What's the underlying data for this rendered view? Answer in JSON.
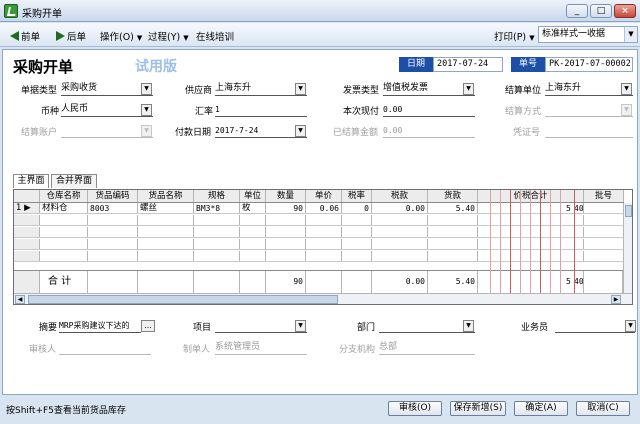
{
  "window": {
    "title": "采购开单",
    "min": "_",
    "max": "□",
    "close": "×"
  },
  "toolbar": {
    "prev": "前单",
    "next": "后单",
    "operate": "操作(O)",
    "process": "过程(Y)",
    "training": "在线培训",
    "print": "打印(P)",
    "style_select": "标准样式一收据",
    "caret": "▼"
  },
  "form": {
    "title": "采购开单",
    "trial": "试用版",
    "date_label": "日期",
    "date_value": "2017-07-24",
    "no_label": "单号",
    "no_value": "PK-2017-07-00002",
    "row1": [
      {
        "label": "单据类型",
        "value": "采购收货"
      },
      {
        "label": "供应商",
        "value": "上海东升"
      },
      {
        "label": "发票类型",
        "value": "增值税发票"
      },
      {
        "label": "结算单位",
        "value": "上海东升"
      }
    ],
    "row2": [
      {
        "label": "币种",
        "value": "人民币"
      },
      {
        "label": "汇率",
        "value": "1"
      },
      {
        "label": "本次现付",
        "value": "0.00"
      },
      {
        "label": "结算方式",
        "value": ""
      }
    ],
    "row3": [
      {
        "label": "结算账户",
        "value": ""
      },
      {
        "label": "付款日期",
        "value": "2017-7-24"
      },
      {
        "label": "已结算金额",
        "value": "0.00"
      },
      {
        "label": "凭证号",
        "value": ""
      }
    ]
  },
  "tabs": {
    "main": "主界面",
    "merge": "合并界面"
  },
  "grid": {
    "headers": [
      "仓库名称",
      "货品编码",
      "货品名称",
      "规格",
      "单位",
      "数量",
      "单价",
      "税率",
      "税款",
      "货款",
      "价税合计",
      "批号"
    ],
    "rows": [
      {
        "idx": "1",
        "marker": "▶",
        "warehouse": "材料仓",
        "code": "8003",
        "name": "螺丝",
        "spec": "BM3*8",
        "unit": "枚",
        "qty": "90",
        "price": "0.06",
        "tax_rate": "0",
        "tax": "0.00",
        "goods": "5.40",
        "total_a": "5",
        "total_b": "40"
      }
    ],
    "totals": {
      "label": "合 计",
      "qty": "90",
      "tax": "0.00",
      "goods": "5.40",
      "total_a": "5",
      "total_b": "40"
    }
  },
  "bottom": {
    "summary_label": "摘要",
    "summary_value": "MRP采购建议下达的",
    "project_label": "项目",
    "dept_label": "部门",
    "staff_label": "业务员",
    "auditor_label": "审核人",
    "maker_label": "制单人",
    "maker_value": "系统管理员",
    "branch_label": "分支机构",
    "branch_value": "总部",
    "more": "..."
  },
  "status": {
    "hint": "按Shift+F5查看当前货品库存",
    "audit": "审核(O)",
    "save_new": "保存新增(S)",
    "confirm": "确定(A)",
    "cancel": "取消(C)"
  }
}
